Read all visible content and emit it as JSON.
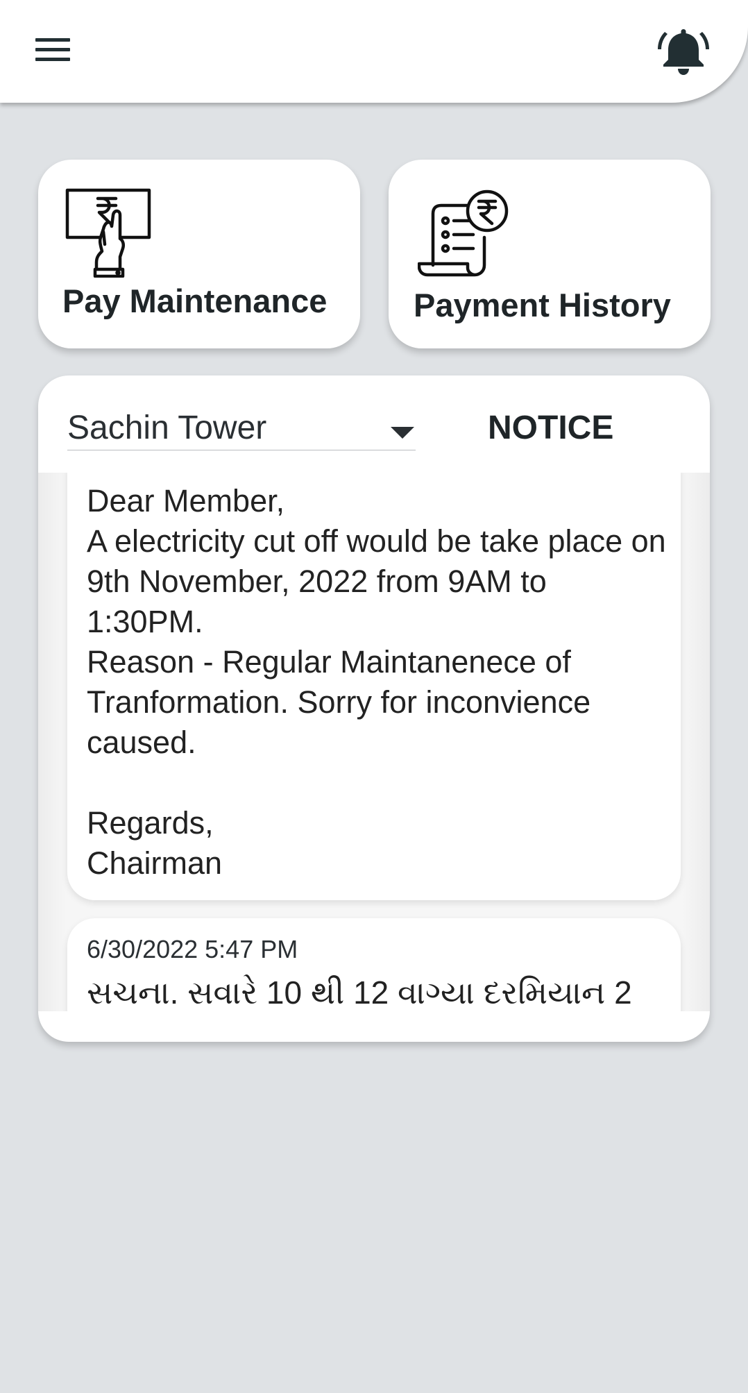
{
  "header": {
    "menu_icon": "hamburger-menu-icon",
    "bell_icon": "notification-bell-icon"
  },
  "actions": {
    "pay": {
      "label": "Pay Maintenance",
      "icon": "rupee-bill-hand-icon"
    },
    "history": {
      "label": "Payment History",
      "icon": "rupee-receipt-list-icon"
    }
  },
  "notice_panel": {
    "society_select": {
      "value": "Sachin Tower"
    },
    "title": "NOTICE",
    "notices": [
      {
        "body": "Dear Member,\nA electricity cut off would be take place on 9th November, 2022 from 9AM to 1:30PM.\nReason - Regular Maintanenece of Tranformation. Sorry for inconvience caused.\n\nRegards,\nChairman"
      },
      {
        "date": "6/30/2022 5:47 PM",
        "preview": "સચના. સવારે 10 થી 12 વાગ્યા દરમિયાન 2"
      }
    ]
  },
  "colors": {
    "background": "#dfe2e5",
    "surface": "#ffffff",
    "icon_dark": "#222f33",
    "text": "#1f2528"
  }
}
